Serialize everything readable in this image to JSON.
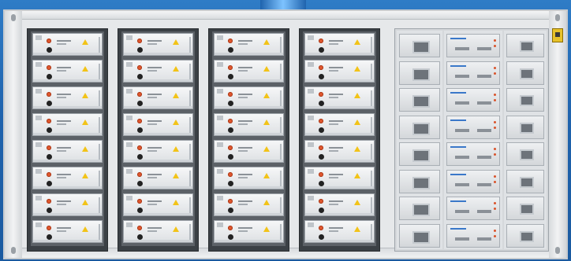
{
  "scene": {
    "subject": "",
    "colors": {
      "sky": "#1f63ad",
      "frame": "#e6e8ea",
      "rack": "#3b4045",
      "module_face": "#f1f2f3",
      "stop_button": "#e0572e",
      "warning": "#f2c318",
      "badge": "#e7c22a"
    }
  },
  "racks": [
    {
      "id": "rack-1",
      "module_labels": [
        "",
        "",
        "",
        "",
        "",
        "",
        "",
        ""
      ]
    },
    {
      "id": "rack-2",
      "module_labels": [
        "",
        "",
        "",
        "",
        "",
        "",
        "",
        ""
      ]
    },
    {
      "id": "rack-3",
      "module_labels": [
        "",
        "",
        "",
        "",
        "",
        "",
        "",
        ""
      ]
    },
    {
      "id": "rack-4",
      "module_labels": [
        "",
        "",
        "",
        "",
        "",
        "",
        "",
        ""
      ]
    }
  ],
  "cabinet": {
    "label": "",
    "columns": [
      "",
      "",
      ""
    ],
    "rows_per_column": 8
  }
}
